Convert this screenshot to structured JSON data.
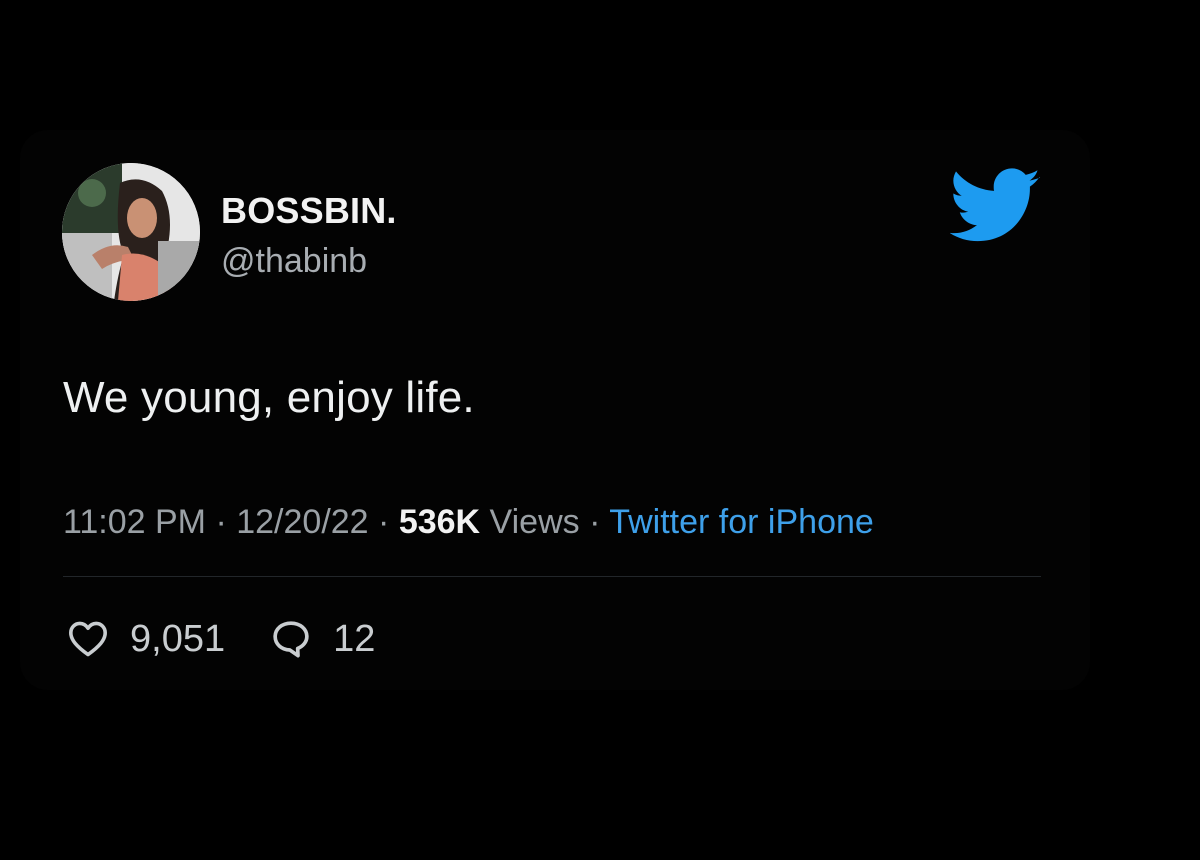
{
  "tweet": {
    "author": {
      "display_name": "BOSSBIN.",
      "handle": "@thabinb",
      "avatar": "avatar-photo"
    },
    "brand_icon": "twitter-bird-icon",
    "text": "We young, enjoy life.",
    "meta": {
      "time": "11:02 PM",
      "separator": " · ",
      "date": "12/20/22",
      "views_count": "536K",
      "views_label": " Views",
      "source": "Twitter for iPhone"
    },
    "stats": {
      "likes": "9,051",
      "replies": "12",
      "like_icon": "heart-icon",
      "reply_icon": "speech-bubble-icon"
    }
  },
  "colors": {
    "background": "#000000",
    "text_primary": "#eef0f1",
    "text_secondary": "#9aa0a5",
    "accent": "#3ea0ea",
    "twitter_blue": "#1d9bf0"
  }
}
